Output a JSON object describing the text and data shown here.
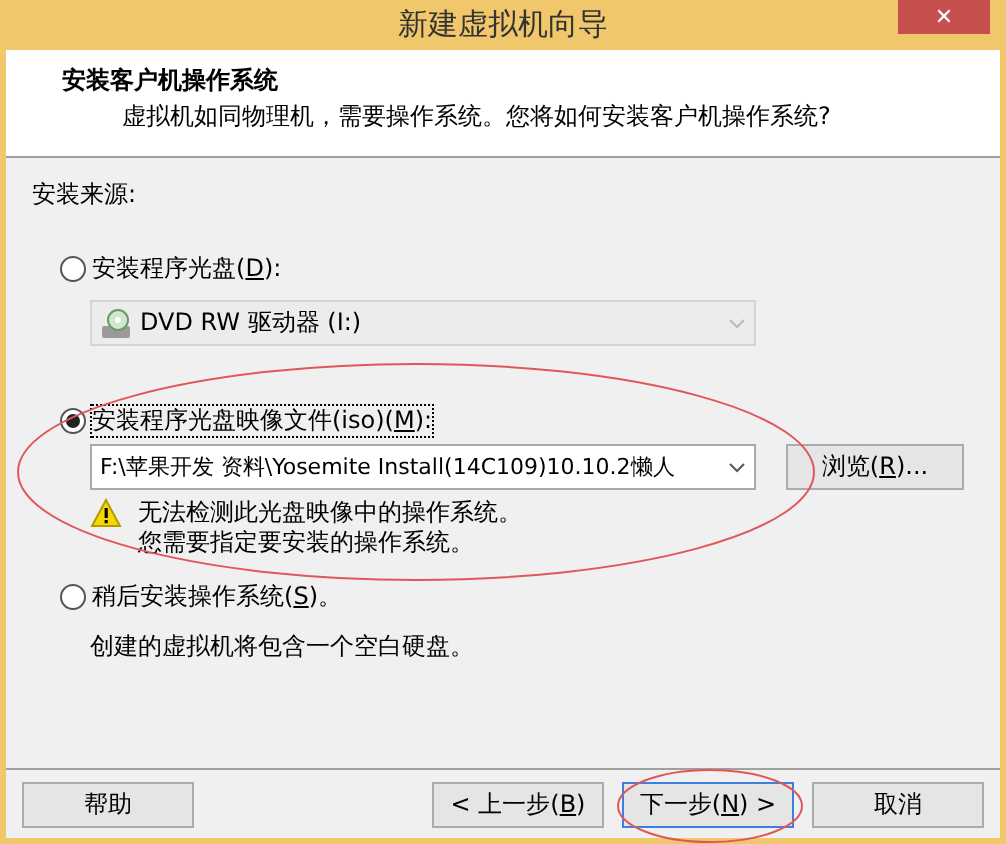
{
  "window": {
    "title": "新建虚拟机向导",
    "close": "✕"
  },
  "header": {
    "title": "安装客户机操作系统",
    "subtitle": "虚拟机如同物理机，需要操作系统。您将如何安装客户机操作系统?"
  },
  "source_label": "安装来源:",
  "options": [
    {
      "kind": "disc",
      "label": "安装程序光盘(",
      "key": "D",
      "after": "):",
      "selected": false,
      "drive": "DVD RW 驱动器 (I:)"
    },
    {
      "kind": "iso",
      "label": "安装程序光盘映像文件(iso)(",
      "key": "M",
      "after": "):",
      "selected": true,
      "path": "F:\\苹果开发 资料\\Yosemite Install(14C109)10.10.2懒人",
      "browse": {
        "label": "浏览(",
        "key": "R",
        "after": ")..."
      },
      "warning": [
        "无法检测此光盘映像中的操作系统。",
        "您需要指定要安装的操作系统。"
      ],
      "highlighted": true
    },
    {
      "kind": "later",
      "label": "稍后安装操作系统(",
      "key": "S",
      "after": ")。",
      "selected": false,
      "note": "创建的虚拟机将包含一个空白硬盘。"
    }
  ],
  "buttons": [
    {
      "label": "帮助",
      "focused": false,
      "highlighted": false
    },
    {
      "label": "< 上一步(",
      "key": "B",
      "after": ")",
      "focused": false,
      "highlighted": false
    },
    {
      "label": "下一步(",
      "key": "N",
      "after": ") >",
      "focused": true,
      "highlighted": true
    },
    {
      "label": "取消",
      "focused": false,
      "highlighted": false
    }
  ]
}
